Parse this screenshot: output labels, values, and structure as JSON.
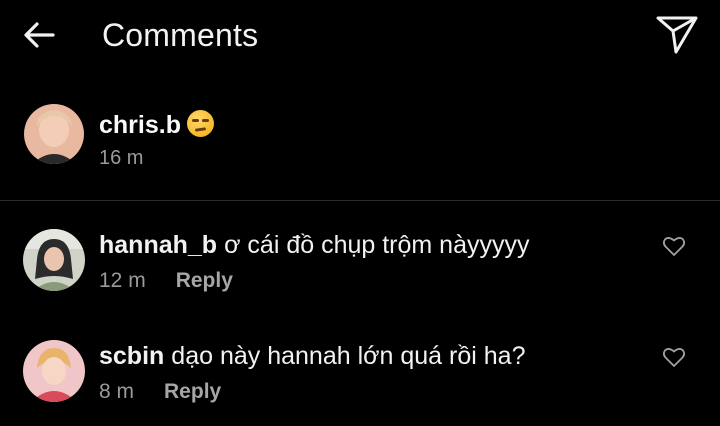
{
  "header": {
    "title": "Comments"
  },
  "caption": {
    "username": "chris.b",
    "emoji_icon": "unamused-face-icon",
    "time": "16 m"
  },
  "comments": [
    {
      "username": "hannah_b",
      "text": "ơ cái đồ chụp trộm nàyyyyy",
      "time": "12 m",
      "reply_label": "Reply"
    },
    {
      "username": "scbin",
      "text": "dạo này hannah lớn quá rồi ha?",
      "time": "8 m",
      "reply_label": "Reply"
    }
  ],
  "colors": {
    "background": "#000000",
    "primary_text": "#f2f2f2",
    "secondary_text": "#9a9a9a",
    "divider": "#2b2b2b"
  }
}
